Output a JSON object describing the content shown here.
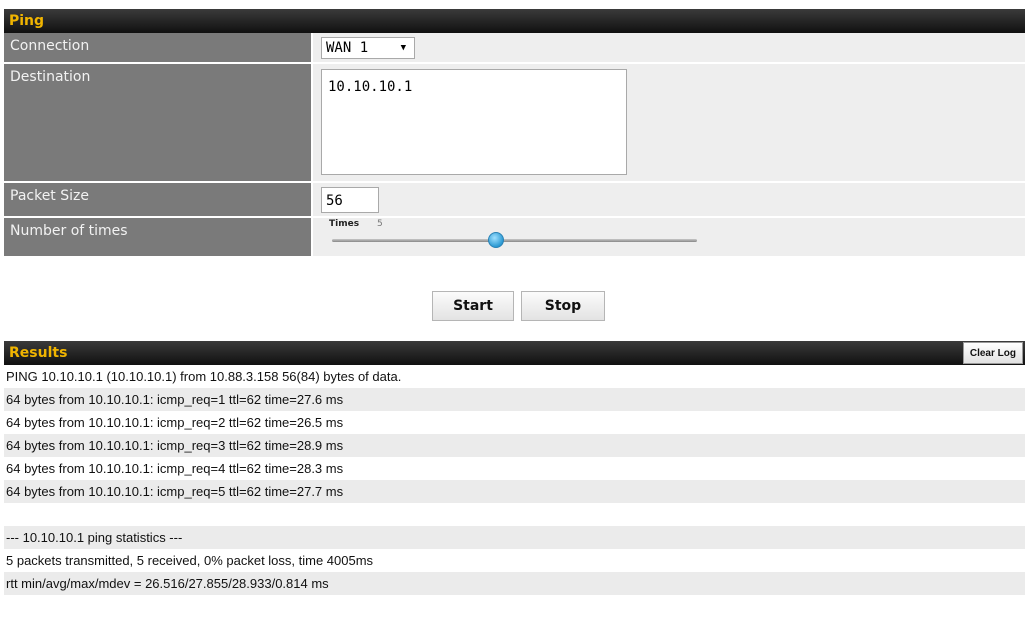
{
  "ping": {
    "title": "Ping",
    "connection": {
      "label": "Connection",
      "value": "WAN 1"
    },
    "destination": {
      "label": "Destination",
      "value": "10.10.10.1"
    },
    "packet_size": {
      "label": "Packet Size",
      "value": "56"
    },
    "number_of_times": {
      "label": "Number of times",
      "slider_label": "Times",
      "value": "5",
      "slider_fraction": 0.45
    }
  },
  "buttons": {
    "start": "Start",
    "stop": "Stop"
  },
  "results": {
    "title": "Results",
    "clear_log": "Clear Log",
    "lines": [
      "PING 10.10.10.1 (10.10.10.1) from 10.88.3.158 56(84) bytes of data.",
      "64 bytes from 10.10.10.1: icmp_req=1 ttl=62 time=27.6 ms",
      "64 bytes from 10.10.10.1: icmp_req=2 ttl=62 time=26.5 ms",
      "64 bytes from 10.10.10.1: icmp_req=3 ttl=62 time=28.9 ms",
      "64 bytes from 10.10.10.1: icmp_req=4 ttl=62 time=28.3 ms",
      "64 bytes from 10.10.10.1: icmp_req=5 ttl=62 time=27.7 ms",
      "",
      "--- 10.10.10.1 ping statistics ---",
      "5 packets transmitted, 5 received, 0% packet loss, time 4005ms",
      "rtt min/avg/max/mdev = 26.516/27.855/28.933/0.814 ms",
      ""
    ]
  },
  "colors": {
    "header_title": "#f0b400",
    "label_bg": "#7a7a7a",
    "value_bg": "#eeeeee",
    "slider_knob": "#2c9ad3"
  }
}
